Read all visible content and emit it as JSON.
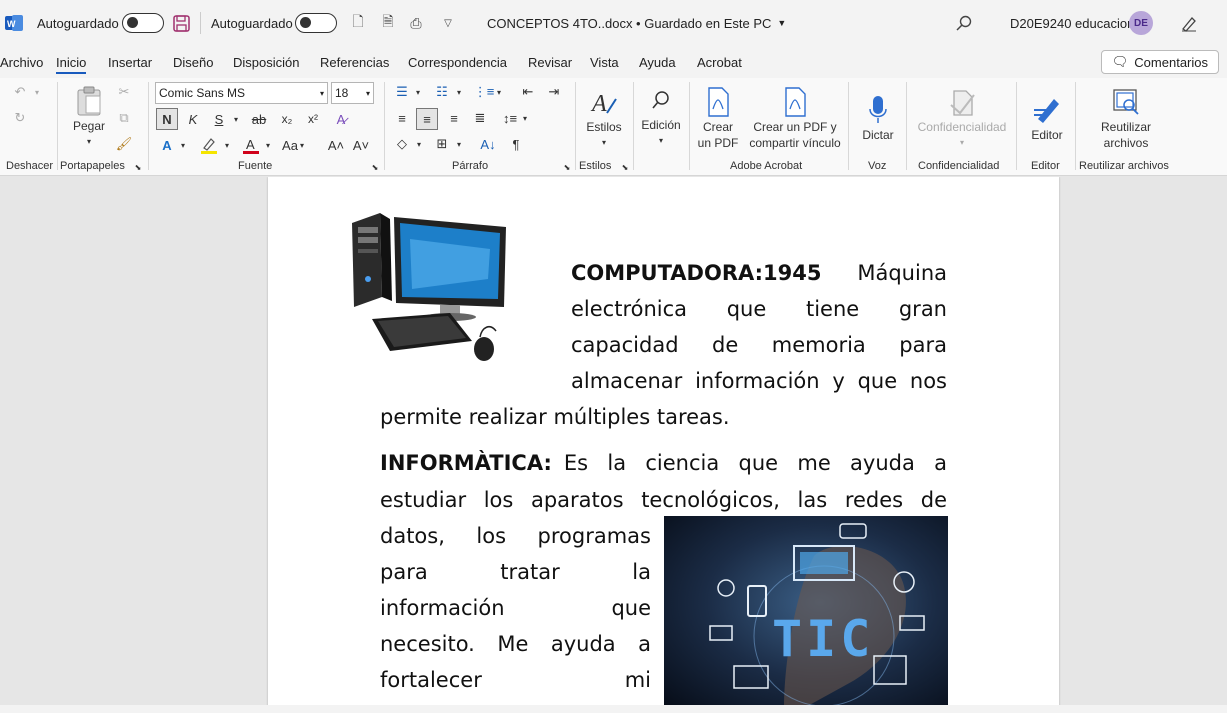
{
  "titlebar": {
    "autosave1": "Autoguardado",
    "autosave2": "Autoguardado",
    "doc_title": "CONCEPTOS 4TO..docx • Guardado en Este PC",
    "user": "D20E9240 educacion",
    "avatar": "DE"
  },
  "menu": {
    "items": [
      "Archivo",
      "Inicio",
      "Insertar",
      "Diseño",
      "Disposición",
      "Referencias",
      "Correspondencia",
      "Revisar",
      "Vista",
      "Ayuda",
      "Acrobat"
    ],
    "comments": "Comentarios"
  },
  "ribbon": {
    "paste": "Pegar",
    "font_name": "Comic Sans MS",
    "font_size": "18",
    "styles": "Estilos",
    "editing": "Edición",
    "create_pdf": "Crear\nun PDF",
    "create_pdf_link": "Crear un PDF y\ncompartir vínculo",
    "dictate": "Dictar",
    "confidentiality": "Confidencialidad",
    "editor": "Editor",
    "reuse_files": "Reutilizar\narchivos",
    "groups": {
      "undo": "Deshacer",
      "clipboard": "Portapapeles",
      "font": "Fuente",
      "paragraph": "Párrafo",
      "styles": "Estilos",
      "acrobat": "Adobe Acrobat",
      "voice": "Voz",
      "confidentiality": "Confidencialidad",
      "editor": "Editor",
      "reuse": "Reutilizar archivos"
    },
    "buttons": {
      "bold": "N",
      "italic": "K",
      "underline": "S",
      "strike": "ab",
      "subscript": "x₂",
      "superscript": "x²",
      "case": "Aa"
    }
  },
  "document": {
    "p1_heading": "COMPUTADORA:1945",
    "p1_lines": [
      "Máquina",
      "electrónica que tiene gran",
      "capacidad de memoria para",
      "almacenar información y que nos",
      "permite realizar múltiples tareas."
    ],
    "p2_heading": "INFORMÀTICA:",
    "p2_line1": "Es la ciencia que me ayuda a",
    "p2_line2": "estudiar los aparatos tecnológicos, las redes de",
    "p2_wrap": [
      "datos, los programas",
      "para tratar la",
      "información que",
      "necesito. Me ayuda a",
      "fortalecer mi"
    ],
    "tic_label": "TIC"
  },
  "colors": {
    "accent": "#185abd",
    "purple_avatar": "#b8a6d9"
  }
}
